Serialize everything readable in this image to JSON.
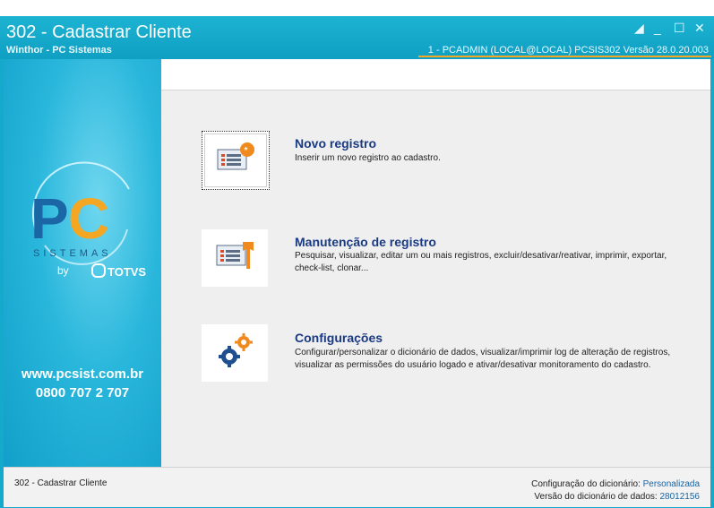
{
  "window": {
    "title": "302 - Cadastrar Cliente",
    "subtitle": "Winthor - PC Sistemas",
    "connection": "1 - PCADMIN (LOCAL@LOCAL)   PCSIS302   Versão  28.0.20.003"
  },
  "sidebar": {
    "logo_letters": "PC",
    "logo_word": "SISTEMAS",
    "by": "by",
    "partner": "TOTVS",
    "url": "www.pcsist.com.br",
    "phone": "0800 707 2 707"
  },
  "options": [
    {
      "title": "Novo registro",
      "description": "Inserir um novo registro ao cadastro."
    },
    {
      "title": "Manutenção de registro",
      "description": "Pesquisar, visualizar, editar um ou mais registros, excluir/desativar/reativar, imprimir, exportar, check-list,  clonar..."
    },
    {
      "title": "Configurações",
      "description": "Configurar/personalizar o dicionário de dados, visualizar/imprimir log de alteração de registros, visualizar as permissões do usuário logado e ativar/desativar monitoramento do cadastro."
    }
  ],
  "status": {
    "left": "302 - Cadastrar Cliente",
    "dict_config_label": "Configuração do dicionário:",
    "dict_config_value": "Personalizada",
    "dict_version_label": "Versão do dicionário de dados:",
    "dict_version_value": "28012156"
  },
  "colors": {
    "titlebar": "#15aacb",
    "accent_orange": "#f5a623",
    "option_title": "#1a3a82"
  }
}
